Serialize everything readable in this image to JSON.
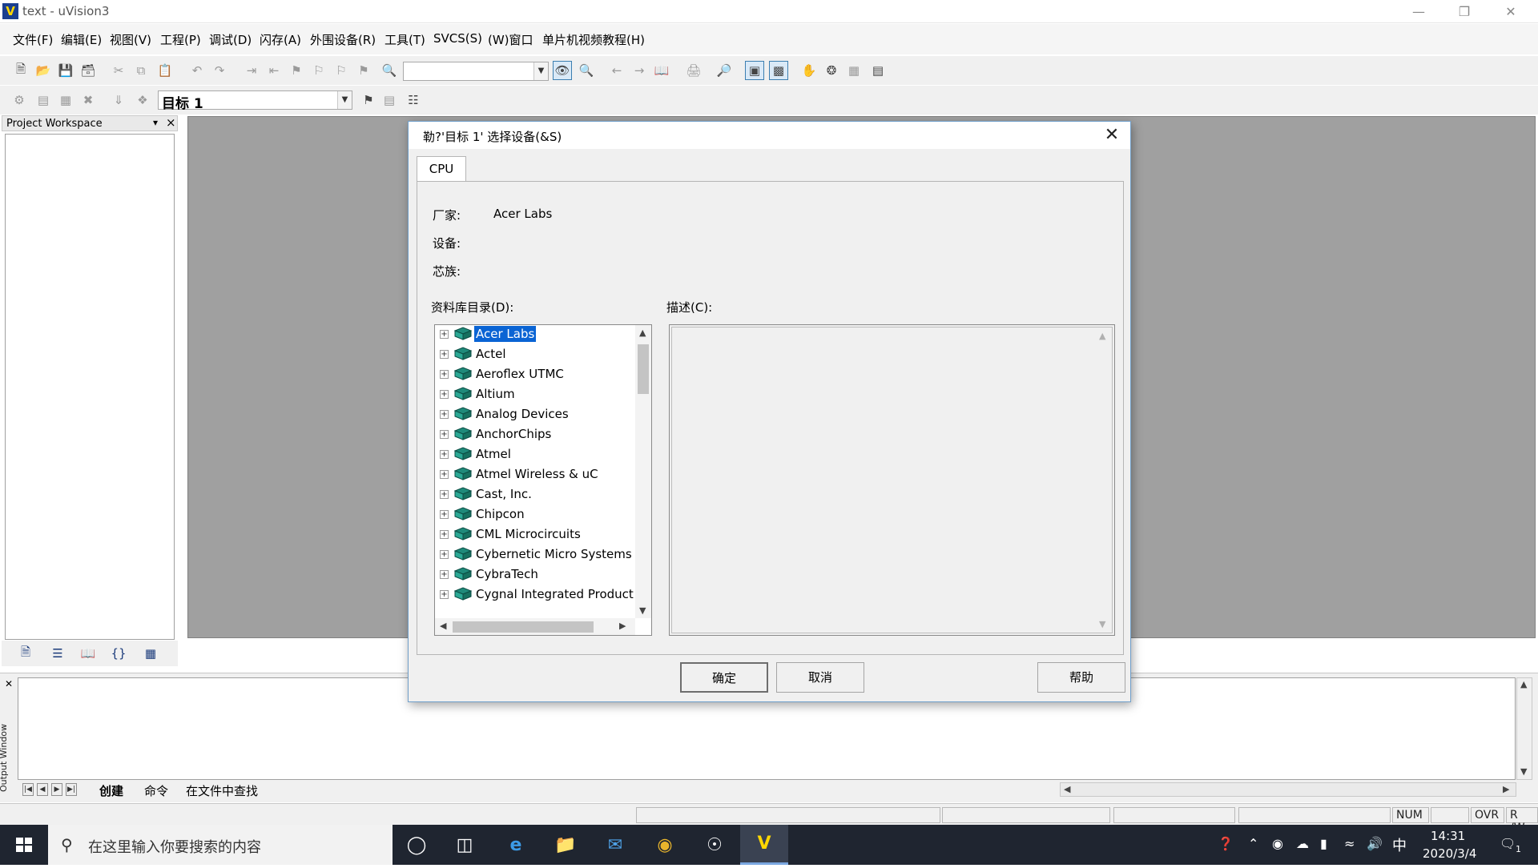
{
  "window": {
    "title": "text  - uVision3",
    "app_icon_glyph": "V"
  },
  "menubar": {
    "items": [
      "文件(F)",
      "编辑(E)",
      "视图(V)",
      "工程(P)",
      "调试(D)",
      "闪存(A)",
      "外围设备(R)",
      "工具(T)",
      "SVCS(S)",
      "(W)窗口",
      "单片机视频教程(H)"
    ]
  },
  "toolbar2": {
    "target_combo": "目标 1"
  },
  "workspace": {
    "title": "Project Workspace",
    "pin": "▾",
    "close": "×"
  },
  "dialog": {
    "title": "勒?'目标 1' 选择设备(&S)",
    "tab": "CPU",
    "vendor_label": "厂家:",
    "vendor_value": "Acer Labs",
    "device_label": "设备:",
    "family_label": "芯族:",
    "db_label": "资料库目录(D):",
    "desc_label": "描述(C):",
    "tree_items": [
      "Acer Labs",
      "Actel",
      "Aeroflex UTMC",
      "Altium",
      "Analog Devices",
      "AnchorChips",
      "Atmel",
      "Atmel Wireless & uC",
      "Cast, Inc.",
      "Chipcon",
      "CML Microcircuits",
      "Cybernetic Micro Systems",
      "CybraTech",
      "Cygnal Integrated Product"
    ],
    "selected_index": 0,
    "buttons": {
      "ok": "确定",
      "cancel": "取消",
      "help": "帮助"
    }
  },
  "output": {
    "vertical_label": "Output Window",
    "tabs": [
      "创建",
      "命令",
      "在文件中查找"
    ]
  },
  "statusbar": {
    "num": "NUM",
    "ovr": "OVR",
    "rw": "R /W"
  },
  "taskbar": {
    "search_placeholder": "在这里输入你要搜索的内容",
    "ime": "中",
    "time": "14:31",
    "date": "2020/3/4",
    "notifications": "1"
  },
  "colors": {
    "accent": "#0a64d4",
    "mdi_bg": "#a0a0a0",
    "taskbar_bg": "#1f2530"
  }
}
